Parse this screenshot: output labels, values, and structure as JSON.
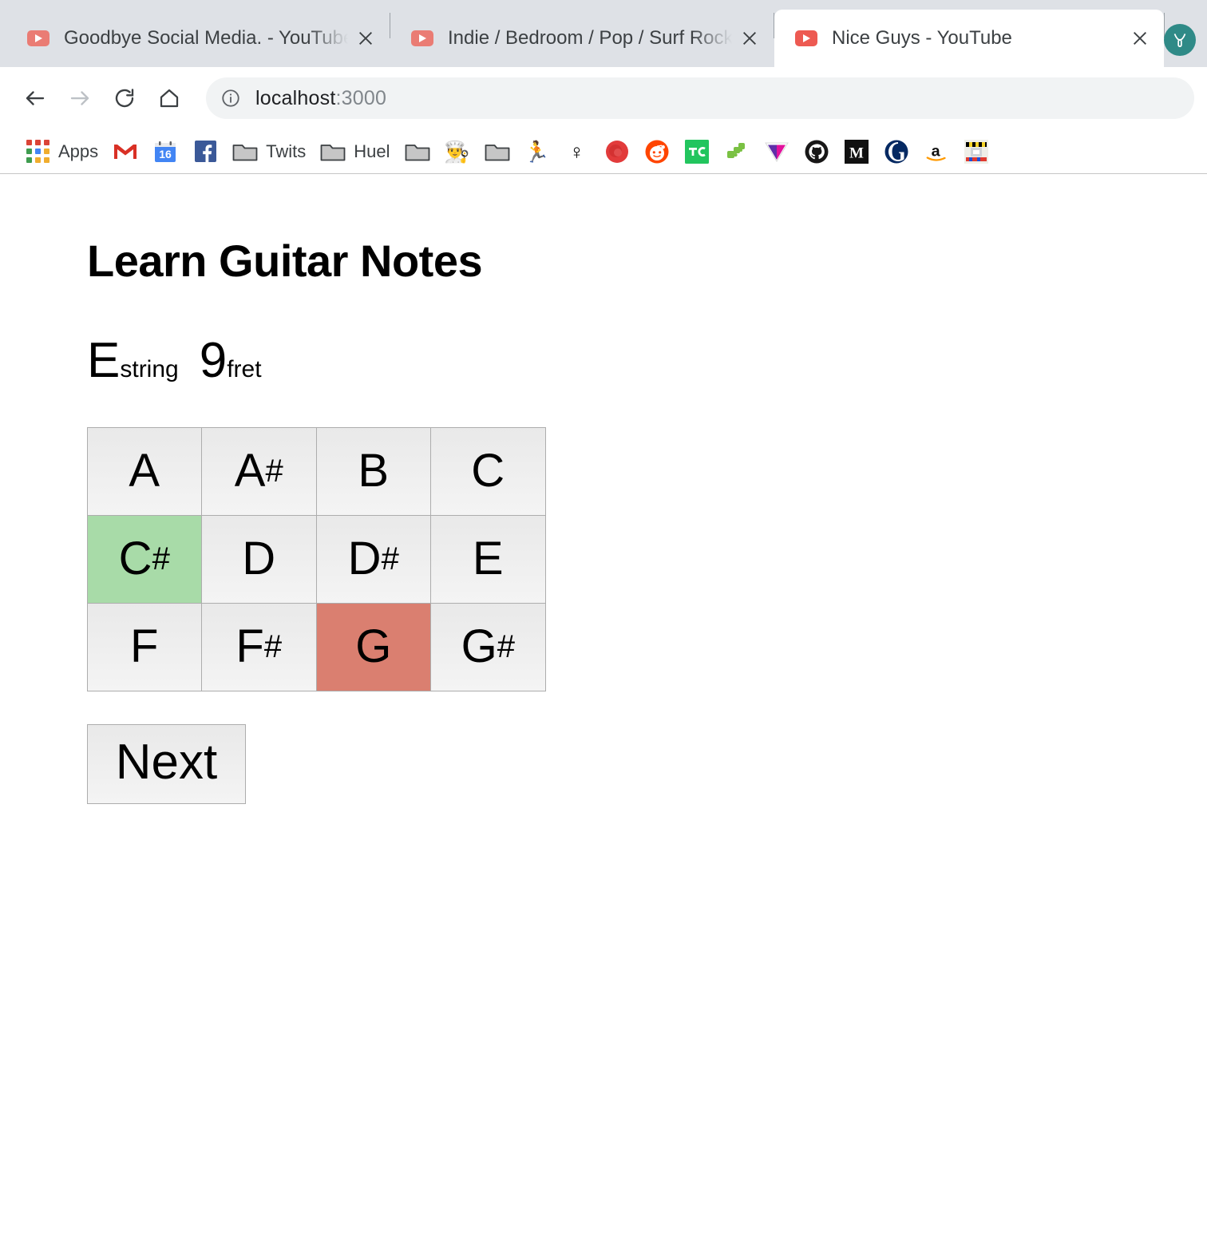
{
  "browser": {
    "tabs": [
      {
        "title": "Goodbye Social Media. - YouTube",
        "icon": "youtube-icon",
        "active": false,
        "close_icon": "close-icon"
      },
      {
        "title": "Indie / Bedroom / Pop / Surf Rock",
        "icon": "youtube-icon",
        "active": false,
        "close_icon": "close-icon"
      },
      {
        "title": "Nice Guys - YouTube",
        "icon": "youtube-icon",
        "active": true,
        "close_icon": "close-icon"
      }
    ],
    "profile": {
      "icon": "profile-avatar-icon",
      "color": "#2f8a87"
    },
    "toolbar": {
      "back_icon": "back-arrow-icon",
      "forward_icon": "forward-arrow-icon",
      "reload_icon": "reload-icon",
      "home_icon": "home-icon",
      "omnibox": {
        "info_icon": "info-circle-icon",
        "host": "localhost",
        "port": ":3000",
        "full_url": "localhost:3000"
      }
    },
    "bookmarks": [
      {
        "label": "Apps",
        "icon": "apps-grid-icon",
        "type": "grid"
      },
      {
        "label": "",
        "icon": "gmail-icon",
        "type": "svg"
      },
      {
        "label": "",
        "icon": "google-calendar-icon",
        "type": "svg",
        "badge": "16"
      },
      {
        "label": "",
        "icon": "facebook-icon",
        "type": "svg"
      },
      {
        "label": "Twits",
        "icon": "folder-icon",
        "type": "folder"
      },
      {
        "label": "Huel",
        "icon": "folder-icon",
        "type": "folder"
      },
      {
        "label": "",
        "icon": "folder-icon",
        "type": "folder"
      },
      {
        "label": "",
        "icon": "chef-emoji-icon",
        "type": "emoji",
        "glyph": "👨‍🍳"
      },
      {
        "label": "",
        "icon": "folder-icon",
        "type": "folder"
      },
      {
        "label": "",
        "icon": "runner-emoji-icon",
        "type": "emoji",
        "glyph": "🏃"
      },
      {
        "label": "",
        "icon": "female-sign-icon",
        "type": "emoji",
        "glyph": "♀"
      },
      {
        "label": "",
        "icon": "red-blob-icon",
        "type": "svg"
      },
      {
        "label": "",
        "icon": "reddit-icon",
        "type": "svg"
      },
      {
        "label": "",
        "icon": "techcrunch-icon",
        "type": "svg",
        "glyph": "TC"
      },
      {
        "label": "",
        "icon": "green-puzzle-icon",
        "type": "svg"
      },
      {
        "label": "",
        "icon": "the-verge-icon",
        "type": "svg"
      },
      {
        "label": "",
        "icon": "github-icon",
        "type": "svg"
      },
      {
        "label": "",
        "icon": "medium-icon",
        "type": "svg",
        "glyph": "M"
      },
      {
        "label": "",
        "icon": "guardian-icon",
        "type": "svg",
        "glyph": "G"
      },
      {
        "label": "",
        "icon": "amazon-icon",
        "type": "svg",
        "glyph": "a"
      },
      {
        "label": "",
        "icon": "pixel-art-icon",
        "type": "svg"
      }
    ]
  },
  "app": {
    "title": "Learn Guitar Notes",
    "prompt": {
      "string_value": "E",
      "string_label": "string",
      "fret_value": "9",
      "fret_label": "fret"
    },
    "notes": [
      {
        "letter": "A",
        "sharp": "",
        "state": "default"
      },
      {
        "letter": "A",
        "sharp": "#",
        "state": "default"
      },
      {
        "letter": "B",
        "sharp": "",
        "state": "default"
      },
      {
        "letter": "C",
        "sharp": "",
        "state": "default"
      },
      {
        "letter": "C",
        "sharp": "#",
        "state": "correct"
      },
      {
        "letter": "D",
        "sharp": "",
        "state": "default"
      },
      {
        "letter": "D",
        "sharp": "#",
        "state": "default"
      },
      {
        "letter": "E",
        "sharp": "",
        "state": "default"
      },
      {
        "letter": "F",
        "sharp": "",
        "state": "default"
      },
      {
        "letter": "F",
        "sharp": "#",
        "state": "default"
      },
      {
        "letter": "G",
        "sharp": "",
        "state": "wrong"
      },
      {
        "letter": "G",
        "sharp": "#",
        "state": "default"
      }
    ],
    "next_label": "Next",
    "colors": {
      "correct": "#a8dba8",
      "wrong": "#da7f70",
      "button": "#f0f0f0",
      "button_border": "#adadad"
    }
  }
}
